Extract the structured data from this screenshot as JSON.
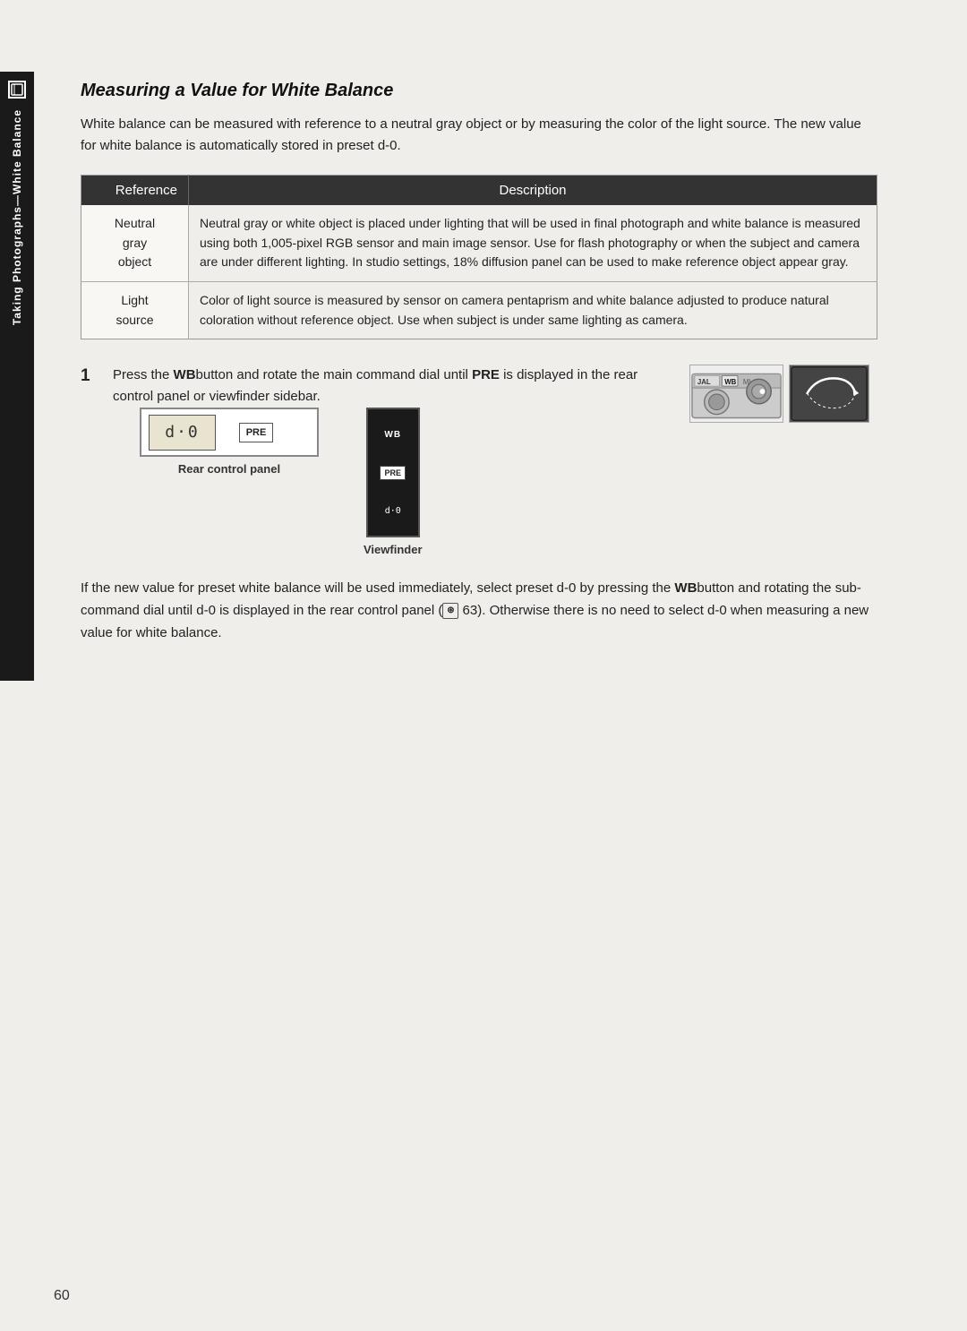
{
  "sidebar": {
    "text": "Taking Photographs—White Balance",
    "icon_label": "WB"
  },
  "page": {
    "number": "60",
    "title": "Measuring a Value for White Balance",
    "intro": "White balance can be measured with reference to a neutral gray object or by measuring the color of the light source.  The new value for white balance is automatically stored in preset d-0.",
    "table": {
      "col1": "Reference",
      "col2": "Description",
      "rows": [
        {
          "ref": "Neutral\ngray\nobject",
          "desc": "Neutral gray or white object is placed under lighting that will be used in final photograph and white balance is measured using both 1,005-pixel RGB sensor and main image sensor.  Use for flash photography or when the subject and camera are under different lighting.  In studio settings, 18% diffusion panel can be used to make reference object appear gray."
        },
        {
          "ref": "Light\nsource",
          "desc": "Color of light source is measured by sensor on camera pentaprism and white balance adjusted to produce natural coloration without reference object.  Use when subject is under same lighting as camera."
        }
      ]
    },
    "step1": {
      "number": "1",
      "text_before_wb": "Press the ",
      "wb_label": "WB",
      "text_after_wb": "button and rotate the main command dial until ",
      "pre_label": "PRE",
      "text_after_pre": " is displayed in the rear control panel or viewfinder sidebar."
    },
    "rear_panel_label": "Rear control panel",
    "viewfinder_label": "Viewfinder",
    "lcd_text": "d·0",
    "pre_text": "PRE",
    "bottom_paragraph": "If the new value for preset white balance will be used immediately, select preset d-0 by pressing the WBbutton and rotating the sub-command dial until d-0 is displayed in the rear control panel (  63).  Otherwise there is no need to select d-0 when measuring a new value for white balance.",
    "bottom_wb": "WB",
    "bottom_ref_num": "63"
  }
}
